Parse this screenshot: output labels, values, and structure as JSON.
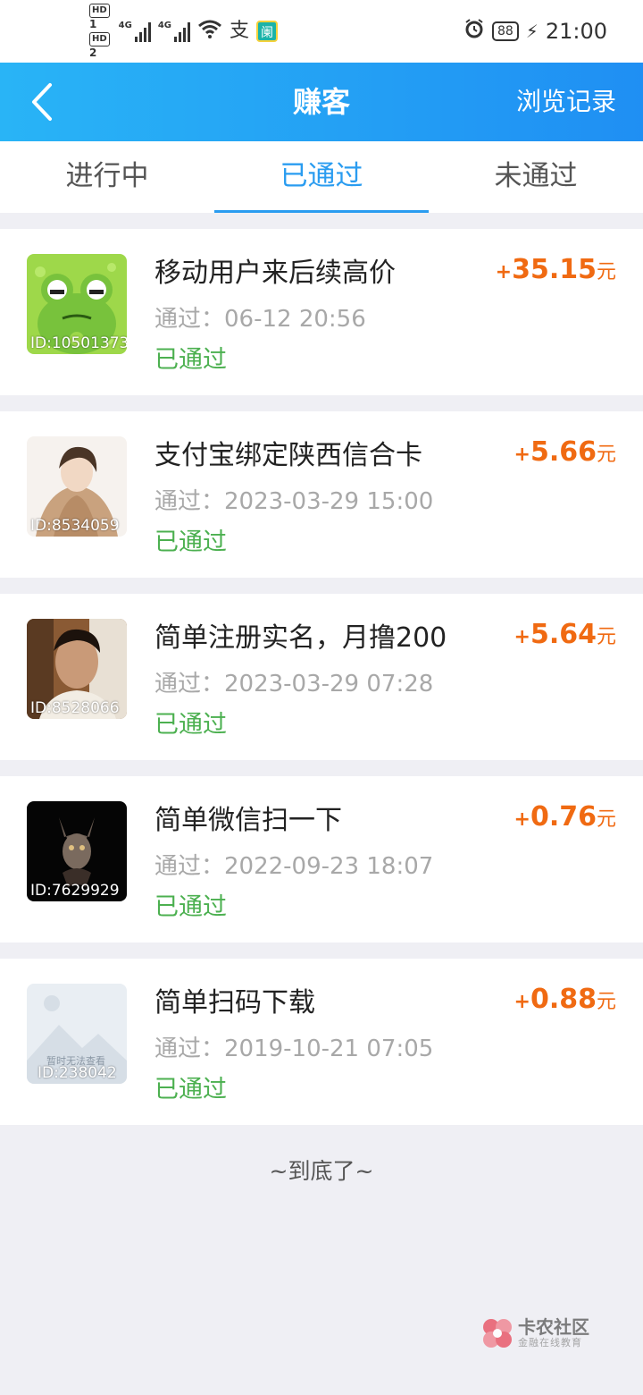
{
  "status_bar": {
    "hd1": "HD",
    "hd1_num": "1",
    "hd2": "HD",
    "hd2_num": "2",
    "sig1_label": "4G",
    "sig2_label": "4G",
    "pay_icon": "支",
    "app_icon": "阑",
    "battery": "88",
    "time": "21:00"
  },
  "header": {
    "title": "赚客",
    "right_link": "浏览记录"
  },
  "tabs": [
    {
      "label": "进行中",
      "active": false
    },
    {
      "label": "已通过",
      "active": true
    },
    {
      "label": "未通过",
      "active": false
    }
  ],
  "tasks": [
    {
      "thumb_id": "ID:10501373",
      "title": "移动用户来后续高价",
      "time": "通过：06-12 20:56",
      "status": "已通过",
      "plus": "+",
      "amount": "35.15",
      "unit": "元",
      "thumb_icon": "frog-avatar"
    },
    {
      "thumb_id": "ID:8534059",
      "title": "支付宝绑定陕西信合卡",
      "time": "通过：2023-03-29 15:00",
      "status": "已通过",
      "plus": "+",
      "amount": "5.66",
      "unit": "元",
      "thumb_icon": "anime-avatar"
    },
    {
      "thumb_id": "ID:8528066",
      "title": "简单注册实名，月撸200",
      "time": "通过：2023-03-29 07:28",
      "status": "已通过",
      "plus": "+",
      "amount": "5.64",
      "unit": "元",
      "thumb_icon": "photo-avatar"
    },
    {
      "thumb_id": "ID:7629929",
      "title": "简单微信扫一下",
      "time": "通过：2022-09-23 18:07",
      "status": "已通过",
      "plus": "+",
      "amount": "0.76",
      "unit": "元",
      "thumb_icon": "dark-creature-avatar"
    },
    {
      "thumb_id": "ID:238042",
      "title": "简单扫码下载",
      "time": "通过：2019-10-21 07:05",
      "status": "已通过",
      "plus": "+",
      "amount": "0.88",
      "unit": "元",
      "thumb_icon": "image-placeholder",
      "thumb_caption": "暂时无法查看"
    }
  ],
  "footer": {
    "end_text": "~到底了~"
  },
  "watermark": {
    "main": "卡农社区",
    "sub": "金融在线教育"
  },
  "colors": {
    "header_start": "#29b4f6",
    "header_end": "#1f8ff3",
    "tab_active": "#2a9cf0",
    "reward": "#f06a12",
    "status_ok": "#4cb050"
  }
}
